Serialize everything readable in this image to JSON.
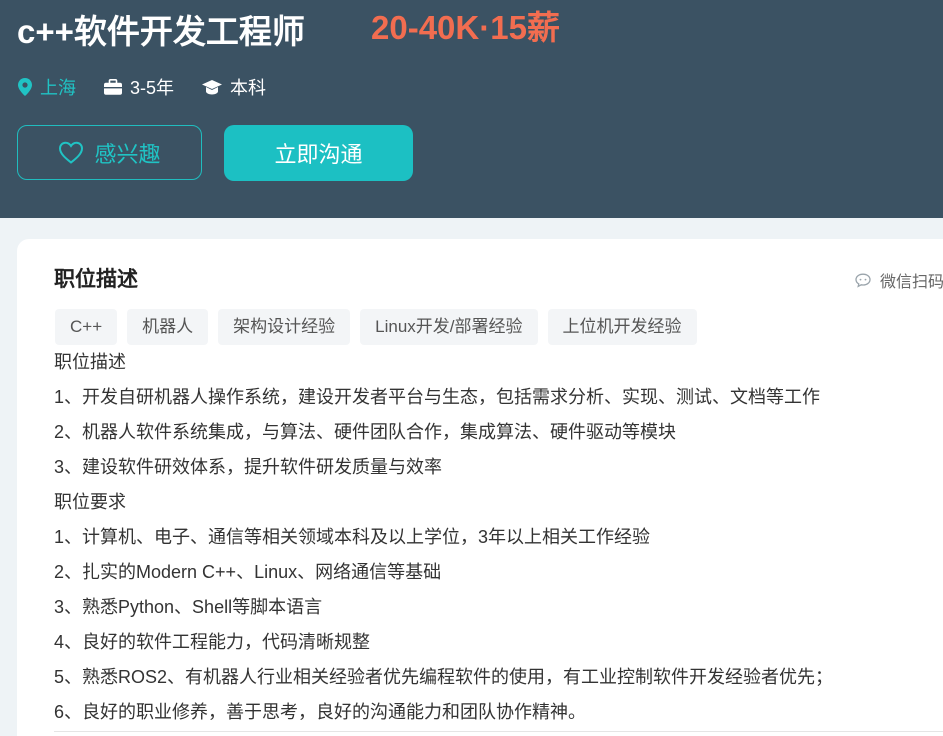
{
  "job": {
    "title": "c++软件开发工程师",
    "salary": "20-40K·15薪",
    "city": "上海",
    "experience": "3-5年",
    "education": "本科"
  },
  "actions": {
    "interest_label": "感兴趣",
    "chat_label": "立即沟通"
  },
  "section": {
    "title": "职位描述",
    "wechat_scan": "微信扫码"
  },
  "tags": [
    "C++",
    "机器人",
    "架构设计经验",
    "Linux开发/部署经验",
    "上位机开发经验"
  ],
  "description": [
    "职位描述",
    "1、开发自研机器人操作系统，建设开发者平台与生态，包括需求分析、实现、测试、文档等工作",
    "2、机器人软件系统集成，与算法、硬件团队合作，集成算法、硬件驱动等模块",
    "3、建设软件研效体系，提升软件研发质量与效率",
    "职位要求",
    "1、计算机、电子、通信等相关领域本科及以上学位，3年以上相关工作经验",
    "2、扎实的Modern C++、Linux、网络通信等基础",
    "3、熟悉Python、Shell等脚本语言",
    "4、良好的软件工程能力，代码清晰规整",
    "5、熟悉ROS2、有机器人行业相关经验者优先编程软件的使用，有工业控制软件开发经验者优先；",
    "6、良好的职业修养，善于思考，良好的沟通能力和团队协作精神。"
  ],
  "icons": {
    "location": "location-pin-icon",
    "experience": "briefcase-icon",
    "education": "graduation-cap-icon",
    "interest": "heart-icon",
    "wechat": "chat-bubble-icon"
  },
  "colors": {
    "header_bg": "#3b5263",
    "accent": "#1cc0c3",
    "salary": "#f26d50"
  }
}
